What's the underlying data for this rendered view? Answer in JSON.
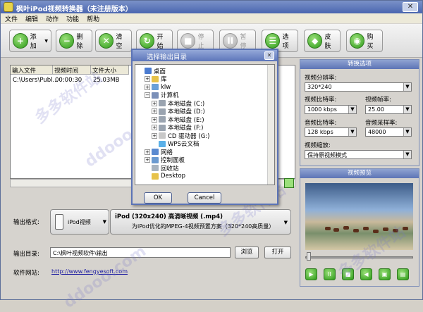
{
  "app": {
    "title": "枫叶iPod视频转换器（未注册版本）",
    "close": "✕"
  },
  "menu": [
    "文件",
    "编辑",
    "动作",
    "功能",
    "帮助"
  ],
  "toolbar": [
    {
      "label": "添加",
      "icon": "+",
      "name": "add-button",
      "dropdown": "▼"
    },
    {
      "label": "删除",
      "icon": "−",
      "name": "delete-button"
    },
    {
      "label": "清空",
      "icon": "✕",
      "name": "clear-button"
    },
    {
      "label": "开始",
      "icon": "↻",
      "name": "start-button"
    },
    {
      "label": "停止",
      "icon": "■",
      "name": "stop-button",
      "disabled": true
    },
    {
      "label": "暂停",
      "icon": "II",
      "name": "pause-button",
      "disabled": true
    },
    {
      "label": "选项",
      "icon": "☰",
      "name": "options-button"
    },
    {
      "label": "皮肤",
      "icon": "◆",
      "name": "skin-button"
    },
    {
      "label": "购买",
      "icon": "◉",
      "name": "buy-button"
    }
  ],
  "list": {
    "headers": [
      "输入文件",
      "视频时间",
      "文件大小"
    ],
    "rows": [
      [
        "C:\\Users\\Publ...",
        "00:00:30",
        "25.03MB"
      ]
    ]
  },
  "settings": {
    "title": "转换选项",
    "resolution_label": "视频分辨率:",
    "resolution": "320*240",
    "vbitrate_label": "视频比特率:",
    "vbitrate": "1000 kbps",
    "framerate_label": "视频帧率:",
    "framerate": "25.00",
    "abitrate_label": "音频比特率:",
    "abitrate": "128 kbps",
    "samplerate_label": "音频采样率:",
    "samplerate": "48000",
    "scale_label": "视频缩放:",
    "scale": "保持原视频模式"
  },
  "preview": {
    "title": "视频预览",
    "buttons": [
      "▶",
      "II",
      "■",
      "◀",
      "▣",
      "▤"
    ]
  },
  "output": {
    "format_label": "输出格式:",
    "device": "iPod视频",
    "profile_title": "iPod (320x240) 高清晰视频 (.mp4)",
    "profile_desc": "为iPod优化的MPEG-4视频预置方案（320*240高质量）",
    "dir_label": "输出目录:",
    "dir_value": "C:\\枫叶视频软件\\输出",
    "browse": "浏览",
    "open": "打开",
    "site_label": "软件网站:",
    "site_url": "http://www.fengyesoft.com"
  },
  "dialog": {
    "title": "选择输出目录",
    "close": "✕",
    "ok": "OK",
    "cancel": "Cancel",
    "tree": [
      {
        "label": "桌面",
        "level": 0,
        "exp": "",
        "color": "#4a7bd0"
      },
      {
        "label": "库",
        "level": 1,
        "exp": "+",
        "color": "#e6c24a"
      },
      {
        "label": "klw",
        "level": 1,
        "exp": "+",
        "color": "#6aa0d8"
      },
      {
        "label": "计算机",
        "level": 1,
        "exp": "−",
        "color": "#7a8fb8"
      },
      {
        "label": "本地磁盘 (C:)",
        "level": 2,
        "exp": "+",
        "color": "#9aa4b0"
      },
      {
        "label": "本地磁盘 (D:)",
        "level": 2,
        "exp": "+",
        "color": "#9aa4b0"
      },
      {
        "label": "本地磁盘 (E:)",
        "level": 2,
        "exp": "+",
        "color": "#9aa4b0"
      },
      {
        "label": "本地磁盘 (F:)",
        "level": 2,
        "exp": "+",
        "color": "#9aa4b0"
      },
      {
        "label": "CD 驱动器 (G:)",
        "level": 2,
        "exp": "+",
        "color": "#c8c8c8"
      },
      {
        "label": "WPS云文档",
        "level": 2,
        "exp": "",
        "color": "#5ab0e8"
      },
      {
        "label": "网络",
        "level": 1,
        "exp": "+",
        "color": "#5a8ad0"
      },
      {
        "label": "控制面板",
        "level": 1,
        "exp": "+",
        "color": "#6a9ad0"
      },
      {
        "label": "回收站",
        "level": 1,
        "exp": "",
        "color": "#a8b4c0"
      },
      {
        "label": "Desktop",
        "level": 1,
        "exp": "",
        "color": "#e6c24a"
      }
    ]
  },
  "watermarks": [
    "多多软件站",
    "ddooo.com",
    "多多软件站",
    "多多软件站",
    "ddooo.com"
  ]
}
